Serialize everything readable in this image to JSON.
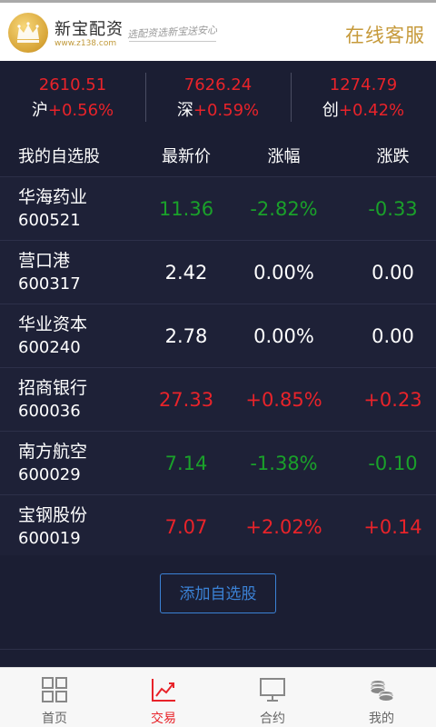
{
  "header": {
    "brand_name": "新宝配资",
    "brand_url": "www.z138.com",
    "slogan": "选配资选新宝送安心",
    "service_label": "在线客服"
  },
  "indexes": [
    {
      "value": "2610.51",
      "name": "沪",
      "change": "+0.56%"
    },
    {
      "value": "7626.24",
      "name": "深",
      "change": "+0.59%"
    },
    {
      "value": "1274.79",
      "name": "创",
      "change": "+0.42%"
    }
  ],
  "table": {
    "headers": {
      "name": "我的自选股",
      "price": "最新价",
      "pct": "涨幅",
      "chg": "涨跌"
    },
    "rows": [
      {
        "name": "华海药业",
        "code": "600521",
        "price": "11.36",
        "pct": "-2.82%",
        "chg": "-0.33",
        "trend": "down"
      },
      {
        "name": "营口港",
        "code": "600317",
        "price": "2.42",
        "pct": "0.00%",
        "chg": "0.00",
        "trend": "flat"
      },
      {
        "name": "华业资本",
        "code": "600240",
        "price": "2.78",
        "pct": "0.00%",
        "chg": "0.00",
        "trend": "flat"
      },
      {
        "name": "招商银行",
        "code": "600036",
        "price": "27.33",
        "pct": "+0.85%",
        "chg": "+0.23",
        "trend": "up"
      },
      {
        "name": "南方航空",
        "code": "600029",
        "price": "7.14",
        "pct": "-1.38%",
        "chg": "-0.10",
        "trend": "down"
      },
      {
        "name": "宝钢股份",
        "code": "600019",
        "price": "7.07",
        "pct": "+2.02%",
        "chg": "+0.14",
        "trend": "up"
      }
    ]
  },
  "add_button_label": "添加自选股",
  "nav": {
    "items": [
      {
        "label": "首页",
        "icon": "grid-icon"
      },
      {
        "label": "交易",
        "icon": "trend-chart-icon"
      },
      {
        "label": "合约",
        "icon": "monitor-icon"
      },
      {
        "label": "我的",
        "icon": "coins-icon"
      }
    ],
    "active": "交易"
  },
  "colors": {
    "up": "#e8232a",
    "down": "#1aa12a",
    "accent_gold": "#c69a3b",
    "accent_blue": "#3b82d6"
  }
}
